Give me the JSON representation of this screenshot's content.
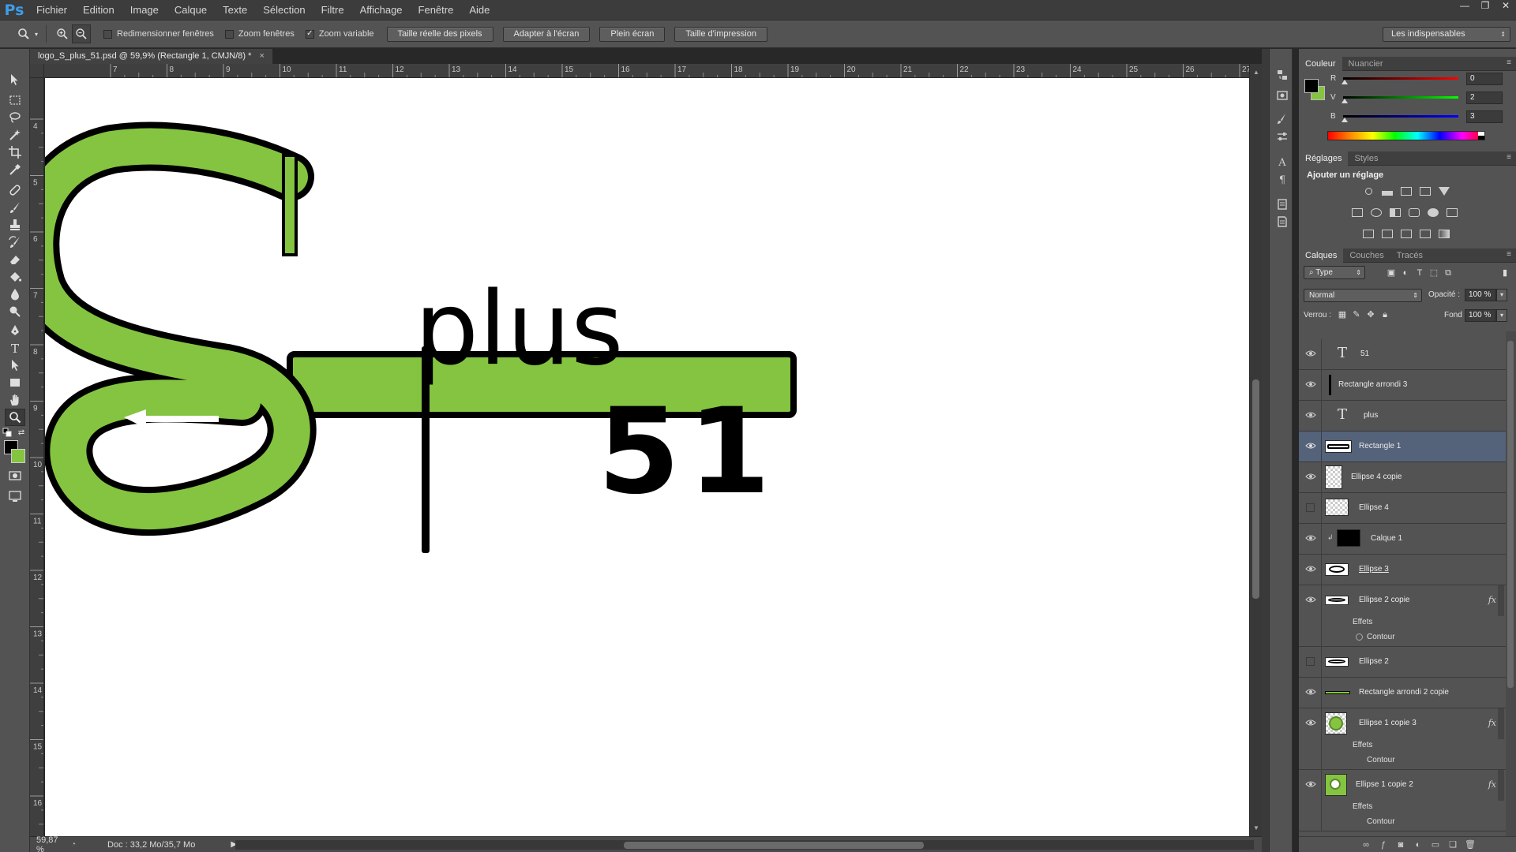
{
  "app": {
    "logo": "Ps"
  },
  "menu": [
    "Fichier",
    "Edition",
    "Image",
    "Calque",
    "Texte",
    "Sélection",
    "Filtre",
    "Affichage",
    "Fenêtre",
    "Aide"
  ],
  "window_controls": {
    "minimize": "—",
    "restore": "❐",
    "close": "✕"
  },
  "options": {
    "checkboxes": [
      {
        "label": "Redimensionner fenêtres",
        "checked": false
      },
      {
        "label": "Zoom fenêtres",
        "checked": false
      },
      {
        "label": "Zoom variable",
        "checked": true
      }
    ],
    "buttons": [
      "Taille réelle des pixels",
      "Adapter à l'écran",
      "Plein écran",
      "Taille d'impression"
    ],
    "workspace": "Les indispensables"
  },
  "document": {
    "tab_title": "logo_S_plus_51.psd @ 59,9% (Rectangle 1, CMJN/8) *",
    "close": "×",
    "logo_text_plus": "plus",
    "logo_text_51": "51",
    "ruler_top": [
      "7",
      "8",
      "9",
      "10",
      "11",
      "12",
      "13",
      "14",
      "15",
      "16",
      "17",
      "18",
      "19",
      "20",
      "21",
      "22",
      "23",
      "24",
      "25",
      "26",
      "27"
    ],
    "ruler_left": [
      "4",
      "5",
      "6",
      "7",
      "8",
      "9",
      "10",
      "11",
      "12",
      "13",
      "14",
      "15",
      "16"
    ]
  },
  "status": {
    "zoom": "59,87 %",
    "doc": "Doc : 33,2 Mo/35,7 Mo"
  },
  "color_panel": {
    "tabs": [
      "Couleur",
      "Nuancier"
    ],
    "sliders": [
      {
        "label": "R",
        "value": "0",
        "gradient": [
          "#000000",
          "#ff0000"
        ]
      },
      {
        "label": "V",
        "value": "2",
        "gradient": [
          "#000000",
          "#00ff00"
        ]
      },
      {
        "label": "B",
        "value": "3",
        "gradient": [
          "#000000",
          "#0000ff"
        ]
      }
    ],
    "foreground": "#000000",
    "background": "#84c441"
  },
  "adjust_panel": {
    "tabs": [
      "Réglages",
      "Styles"
    ],
    "title": "Ajouter un réglage"
  },
  "layers_panel": {
    "tabs": [
      "Calques",
      "Couches",
      "Tracés"
    ],
    "filter": "Type",
    "blend_mode": "Normal",
    "opacity_label": "Opacité :",
    "opacity": "100 %",
    "lock_label": "Verrou :",
    "fill_label": "Fond :",
    "fill": "100 %",
    "layers": [
      {
        "name": "51",
        "visible": true,
        "thumb": "text"
      },
      {
        "name": "Rectangle arrondi 3",
        "visible": true,
        "thumb": "line"
      },
      {
        "name": "plus",
        "visible": true,
        "thumb": "text"
      },
      {
        "name": "Rectangle 1",
        "visible": true,
        "thumb": "rect",
        "selected": true
      },
      {
        "name": "Ellipse 4 copie",
        "visible": true,
        "thumb": "checker"
      },
      {
        "name": "Ellipse 4",
        "visible": false,
        "thumb": "checker"
      },
      {
        "name": "Calque 1",
        "visible": true,
        "thumb": "black"
      },
      {
        "name": "Ellipse 3",
        "visible": true,
        "thumb": "ellipse"
      },
      {
        "name": "Ellipse 2 copie",
        "visible": true,
        "thumb": "ellipse",
        "fx": "fx",
        "effects": [
          "Effets",
          "Contour"
        ]
      },
      {
        "name": "Ellipse 2",
        "visible": false,
        "thumb": "ellipse"
      },
      {
        "name": "Rectangle arrondi 2 copie",
        "visible": true,
        "thumb": "greenline"
      },
      {
        "name": "Ellipse 1 copie 3",
        "visible": true,
        "thumb": "green",
        "fx": "fx",
        "effects": [
          "Effets",
          "Contour"
        ]
      },
      {
        "name": "Ellipse 1 copie 2",
        "visible": true,
        "thumb": "green",
        "fx": "fx",
        "effects": [
          "Effets",
          "Contour"
        ]
      }
    ]
  }
}
